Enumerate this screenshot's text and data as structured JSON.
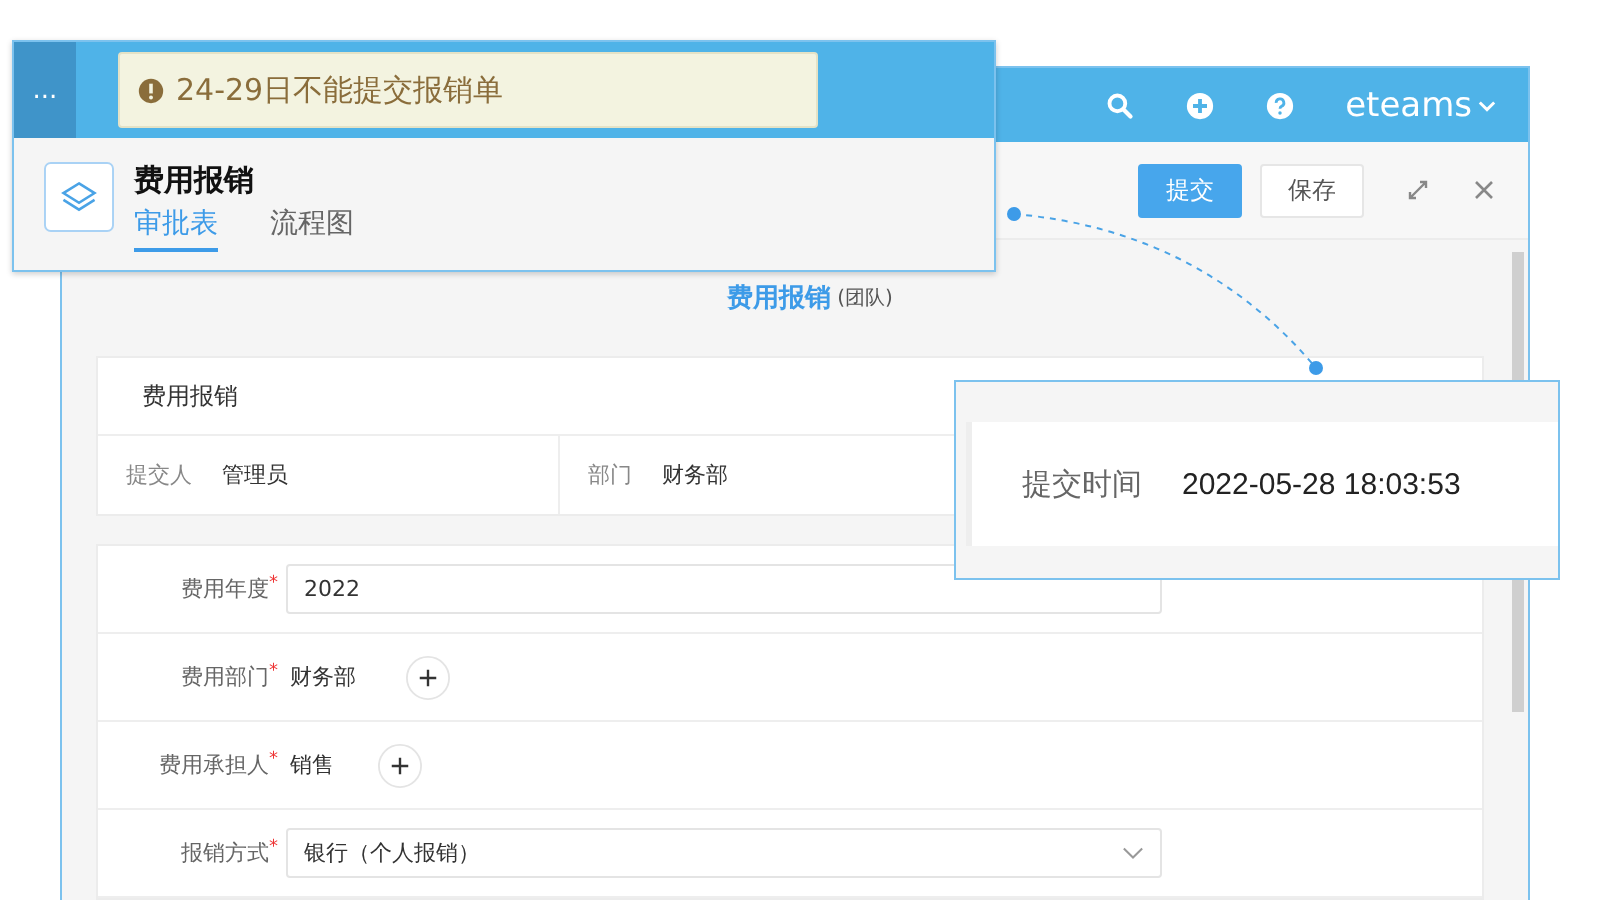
{
  "header": {
    "brand": "eteams",
    "truncated_tab": "..."
  },
  "toolbar": {
    "buttons": [
      {
        "label": "提交",
        "kind": "primary"
      },
      {
        "label": "保存",
        "kind": "default"
      }
    ]
  },
  "form_title": {
    "title": "费用报销",
    "suffix": "(团队)"
  },
  "info_card": {
    "title": "费用报销",
    "cells": [
      {
        "label": "提交人",
        "value": "管理员"
      },
      {
        "label": "部门",
        "value": "财务部"
      }
    ]
  },
  "fields": [
    {
      "label": "费用年度",
      "mark": "*",
      "kind": "input",
      "value": "2022"
    },
    {
      "label": "费用部门",
      "mark": "*",
      "kind": "picker",
      "value": "财务部"
    },
    {
      "label": "费用承担人",
      "mark": "*",
      "kind": "picker",
      "value": "销售"
    },
    {
      "label": "报销方式",
      "mark": "*",
      "kind": "select",
      "value": "银行（个人报销）"
    }
  ],
  "callout_top": {
    "notice": "24-29日不能提交报销单",
    "title": "费用报销",
    "tabs": [
      {
        "label": "审批表",
        "selected": true
      },
      {
        "label": "流程图",
        "selected": false
      }
    ]
  },
  "callout_time": {
    "label": "提交时间",
    "value": "2022-05-28 18:03:53"
  }
}
